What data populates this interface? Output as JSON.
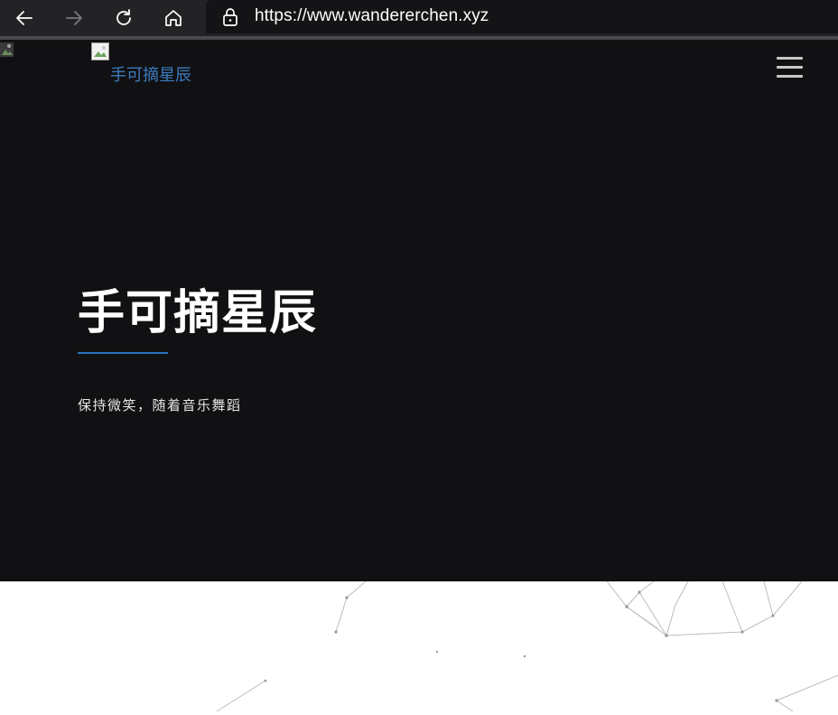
{
  "browser": {
    "url": "https://www.wandererchen.xyz",
    "icons": [
      "back-arrow-icon",
      "forward-arrow-icon",
      "reload-icon",
      "home-icon",
      "lock-icon"
    ]
  },
  "header": {
    "logo_alt": "手可摘星辰",
    "menu_icon": "hamburger-menu-icon"
  },
  "hero": {
    "title": "手可摘星辰",
    "subtitle": "保持微笑，随着音乐舞蹈",
    "accent_color": "#2f71c4",
    "background_color": "#111113"
  }
}
